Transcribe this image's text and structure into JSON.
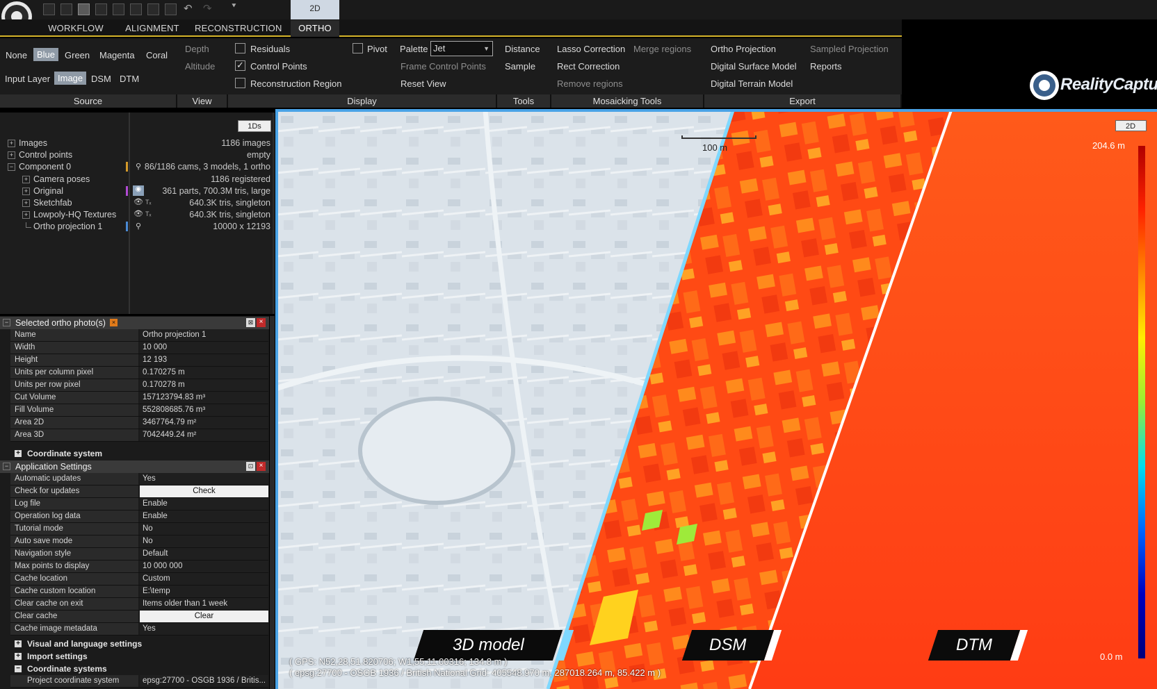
{
  "titlebar": {
    "view_tab": "2D"
  },
  "ribbon_tabs": [
    "WORKFLOW",
    "ALIGNMENT",
    "RECONSTRUCTION",
    "ORTHO"
  ],
  "ribbon": {
    "source": {
      "colors": [
        "None",
        "Blue",
        "Green",
        "Magenta",
        "Coral"
      ],
      "input_layer_label": "Input Layer",
      "layers": [
        "Image",
        "DSM",
        "DTM"
      ],
      "group": "Source"
    },
    "view": {
      "depth": "Depth",
      "altitude": "Altitude",
      "group": "View"
    },
    "display": {
      "residuals": "Residuals",
      "control_points": "Control Points",
      "reconstruction_region": "Reconstruction Region",
      "pivot": "Pivot",
      "palette_label": "Palette",
      "palette_value": "Jet",
      "frame_control_points": "Frame Control Points",
      "reset_view": "Reset View",
      "group": "Display"
    },
    "tools": {
      "distance": "Distance",
      "sample": "Sample",
      "group": "Tools"
    },
    "mosaicking": {
      "lasso": "Lasso Correction",
      "merge": "Merge regions",
      "rect": "Rect Correction",
      "remove": "Remove regions",
      "group": "Mosaicking Tools"
    },
    "export": {
      "ortho": "Ortho Projection",
      "sampled": "Sampled Projection",
      "dsm": "Digital Surface Model",
      "reports": "Reports",
      "dtm": "Digital Terrain Model",
      "group": "Export"
    }
  },
  "brand": "RealityCapture",
  "tree": {
    "button": "1Ds",
    "items": [
      {
        "label": "Images",
        "value": "1186 images"
      },
      {
        "label": "Control points",
        "value": "empty"
      },
      {
        "label": "Component 0",
        "value": "86/1186 cams, 3 models, 1 ortho"
      },
      {
        "label": "Camera poses",
        "value": "1186 registered"
      },
      {
        "label": "Original",
        "value": "361 parts, 700.3M tris, large"
      },
      {
        "label": "Sketchfab",
        "value": "640.3K tris, singleton"
      },
      {
        "label": "Lowpoly-HQ Textures",
        "value": "640.3K tris, singleton"
      },
      {
        "label": "Ortho projection 1",
        "value": "10000 x 12193"
      }
    ]
  },
  "selected_ortho": {
    "title": "Selected ortho photo(s)",
    "rows": [
      {
        "k": "Name",
        "v": "Ortho projection 1"
      },
      {
        "k": "Width",
        "v": "10 000"
      },
      {
        "k": "Height",
        "v": "12 193"
      },
      {
        "k": "Units per column pixel",
        "v": "0.170275 m"
      },
      {
        "k": "Units per row pixel",
        "v": "0.170278 m"
      },
      {
        "k": "Cut Volume",
        "v": "157123794.83 m³"
      },
      {
        "k": "Fill Volume",
        "v": "552808685.76 m³"
      },
      {
        "k": "Area 2D",
        "v": "3467764.79 m²"
      },
      {
        "k": "Area 3D",
        "v": "7042449.24 m²"
      }
    ],
    "sub": "Coordinate system"
  },
  "app_settings": {
    "title": "Application Settings",
    "rows": [
      {
        "k": "Automatic updates",
        "v": "Yes"
      },
      {
        "k": "Check for updates",
        "v": "Check",
        "button": true
      },
      {
        "k": "Log file",
        "v": "Enable"
      },
      {
        "k": "Operation log data",
        "v": "Enable"
      },
      {
        "k": "Tutorial mode",
        "v": "No"
      },
      {
        "k": "Auto save mode",
        "v": "No"
      },
      {
        "k": "Navigation style",
        "v": "Default"
      },
      {
        "k": "Max points to display",
        "v": "10 000 000"
      },
      {
        "k": "Cache location",
        "v": "Custom"
      },
      {
        "k": "Cache custom location",
        "v": "E:\\temp"
      },
      {
        "k": "Clear cache on exit",
        "v": "Items older than 1 week"
      },
      {
        "k": "Clear cache",
        "v": "Clear",
        "button": true
      },
      {
        "k": "Cache image metadata",
        "v": "Yes"
      }
    ],
    "subs": [
      "Visual and language settings",
      "Import settings",
      "Coordinate systems"
    ],
    "last_row": {
      "k": "Project coordinate system",
      "v": "epsg:27700 - OSGB 1936 / Britis..."
    }
  },
  "viewport": {
    "mode_button": "2D",
    "scale": "100 m",
    "legend_top": "204.6 m",
    "legend_bottom": "0.0 m",
    "labels": [
      "3D model",
      "DSM",
      "DTM"
    ],
    "gps_line1": "( GPS: N52,28,51.820706; W1,55,11.00316; 134.8 m )",
    "gps_line2": "( epsg:27700 - OSGB 1936 / British National Grid: 405548.970 m, 287018.264 m, 85.422 m )"
  },
  "colors": {
    "accent": "#d6b52a",
    "selected": "#8f9aa6",
    "viewport_frame": "#4aa3e6"
  }
}
